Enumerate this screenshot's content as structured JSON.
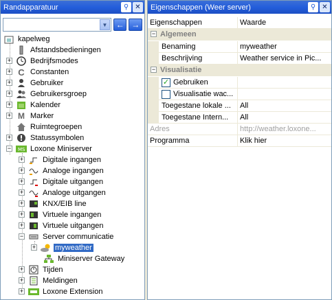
{
  "left_panel": {
    "title": "Randapparatuur",
    "combo_value": "",
    "tree": [
      {
        "label": "kapelweg",
        "icon": "house-icon"
      },
      {
        "label": "Afstandsbedieningen",
        "icon": "remote-icon"
      },
      {
        "label": "Bedrijfsmodes",
        "icon": "clock-icon"
      },
      {
        "label": "Constanten",
        "icon": "constant-icon"
      },
      {
        "label": "Gebruiker",
        "icon": "user-icon"
      },
      {
        "label": "Gebruikersgroep",
        "icon": "users-icon"
      },
      {
        "label": "Kalender",
        "icon": "calendar-icon"
      },
      {
        "label": "Marker",
        "icon": "marker-icon"
      },
      {
        "label": "Ruimtegroepen",
        "icon": "room-icon"
      },
      {
        "label": "Statussymbolen",
        "icon": "status-icon"
      },
      {
        "label": "Loxone Miniserver",
        "icon": "miniserver-icon"
      },
      {
        "label": "Digitale ingangen",
        "icon": "digital-input-icon"
      },
      {
        "label": "Analoge ingangen",
        "icon": "analog-input-icon"
      },
      {
        "label": "Digitale uitgangen",
        "icon": "digital-output-icon"
      },
      {
        "label": "Analoge uitgangen",
        "icon": "analog-output-icon"
      },
      {
        "label": "KNX/EIB line",
        "icon": "knx-icon"
      },
      {
        "label": "Virtuele ingangen",
        "icon": "virtual-input-icon"
      },
      {
        "label": "Virtuele uitgangen",
        "icon": "virtual-output-icon"
      },
      {
        "label": "Server communicatie",
        "icon": "server-icon"
      },
      {
        "label": "myweather",
        "icon": "weather-icon"
      },
      {
        "label": "Miniserver Gateway",
        "icon": "gateway-icon"
      },
      {
        "label": "Tijden",
        "icon": "timer-icon"
      },
      {
        "label": "Meldingen",
        "icon": "messages-icon"
      },
      {
        "label": "Loxone Extension",
        "icon": "extension-icon"
      }
    ]
  },
  "right_panel": {
    "title": "Eigenschappen (Weer server)",
    "header": {
      "col1": "Eigenschappen",
      "col2": "Waarde"
    },
    "categories": {
      "algemeen": "Algemeen",
      "visualisatie": "Visualisatie"
    },
    "props": {
      "benaming": {
        "name": "Benaming",
        "value": "myweather"
      },
      "beschrijving": {
        "name": "Beschrijving",
        "value": "Weather service in Pic..."
      },
      "gebruiken": {
        "name": "Gebruiken",
        "value": ""
      },
      "wachtwoord": {
        "name": "Visualisatie wac...",
        "value": ""
      },
      "lokaal": {
        "name": "Toegestane lokale ...",
        "value": "All"
      },
      "internet": {
        "name": "Toegestane Intern...",
        "value": "All"
      },
      "adres": {
        "name": "Adres",
        "value": "http://weather.loxone..."
      },
      "programma": {
        "name": "Programma",
        "value": "Klik hier"
      }
    }
  }
}
